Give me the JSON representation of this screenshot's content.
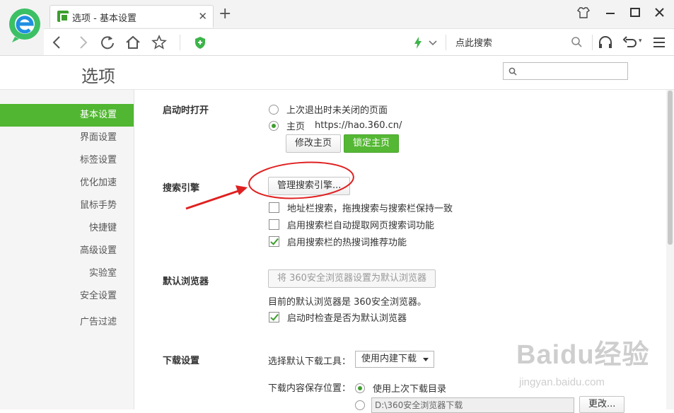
{
  "colors": {
    "accent": "#51b631",
    "annotation": "#e02020"
  },
  "tab": {
    "title": "选项 - 基本设置",
    "favicon": "wrench-icon"
  },
  "addressbar": {
    "search_label": "点此搜索"
  },
  "options": {
    "title": "选项",
    "search_placeholder": ""
  },
  "sidebar": {
    "items": [
      {
        "label": "基本设置",
        "active": true
      },
      {
        "label": "界面设置",
        "active": false
      },
      {
        "label": "标签设置",
        "active": false
      },
      {
        "label": "优化加速",
        "active": false
      },
      {
        "label": "鼠标手势",
        "active": false
      },
      {
        "label": "快捷键",
        "active": false
      },
      {
        "label": "高级设置",
        "active": false
      },
      {
        "label": "实验室",
        "active": false
      },
      {
        "label": "安全设置",
        "active": false
      },
      {
        "label": "广告过滤",
        "active": false
      }
    ]
  },
  "startup": {
    "label": "启动时打开",
    "option_restore": "上次退出时未关闭的页面",
    "option_home": "主页",
    "home_url": "https://hao.360.cn/",
    "selected": "home",
    "modify_button": "修改主页",
    "lock_button": "锁定主页"
  },
  "search": {
    "label": "搜索引擎",
    "manage_button": "管理搜索引擎...",
    "checks": [
      {
        "label": "地址栏搜索，拖拽搜索与搜索栏保持一致",
        "checked": false
      },
      {
        "label": "启用搜索栏自动提取网页搜索词功能",
        "checked": false
      },
      {
        "label": "启用搜索栏的热搜词推荐功能",
        "checked": true
      }
    ]
  },
  "default_browser": {
    "label": "默认浏览器",
    "set_button": "将 360安全浏览器设置为默认浏览器",
    "status": "目前的默认浏览器是 360安全浏览器。",
    "check_label": "启动时检查是否为默认浏览器",
    "check_checked": true
  },
  "download": {
    "label": "下载设置",
    "tool_label": "选择默认下载工具：",
    "tool_value": "使用内建下载",
    "location_label": "下载内容保存位置：",
    "option_last": "使用上次下载目录",
    "path_value": "D:\\360安全浏览器下载",
    "change_button": "更改..."
  },
  "watermark": {
    "brand": "Baidu经验",
    "url": "jingyan.baidu.com"
  }
}
